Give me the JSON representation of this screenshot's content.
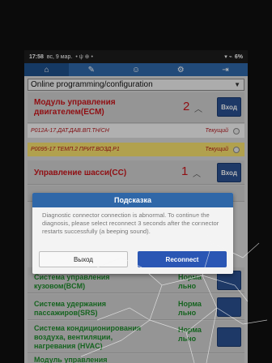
{
  "status_bar": {
    "time": "17:58",
    "date": "вс, 9 мар.",
    "icons": "•  ψ  ⊕  •",
    "signal_icons": "▾ ⌁",
    "battery": "6%"
  },
  "nav": {
    "items": [
      {
        "icon": "home-icon",
        "glyph": "⌂"
      },
      {
        "icon": "edit-icon",
        "glyph": "✎"
      },
      {
        "icon": "person-icon",
        "glyph": "☺"
      },
      {
        "icon": "settings-icon",
        "glyph": "⚙"
      },
      {
        "icon": "exit-icon",
        "glyph": "⇥"
      }
    ]
  },
  "section": {
    "title": "Online programming/configuration"
  },
  "modules": {
    "ecm": {
      "label": "Модуль управления двигателем(ECM)",
      "count": "2",
      "enter": "Вход"
    },
    "cc": {
      "label": "Управление шасси(CC)",
      "count": "1",
      "enter": "Вход"
    }
  },
  "dtcs": [
    {
      "code": "P012A-17.ДАТ.ДАВ.ВП.ТН/СН",
      "state": "Текущий"
    },
    {
      "code": "P0095-17 ТЕМП.2 ПРИТ.ВОЗД.Р1",
      "state": "Текущий"
    }
  ],
  "lower_rows": [
    {
      "label": "Система управления кузовом(BCM)",
      "status": "Норма льно"
    },
    {
      "label": "Система удержания пассажиров(SRS)",
      "status": "Норма льно"
    },
    {
      "label": "Система кондиционирования воздуха, вентиляции, нагревания (HVAC)",
      "status": "Норма льно"
    },
    {
      "label": "Модуль управления",
      "status": ""
    }
  ],
  "dialog": {
    "title": "Подсказка",
    "message": "Diagnostic connector connection is abnormal. To continue the diagnosis, please select reconnect 3 seconds after the connector restarts successfully (a beeping sound).",
    "exit_label": "Выход",
    "reconnect_label": "Reconnect"
  },
  "colors": {
    "nav_blue": "#2f67a8",
    "fault_red": "#c8151b",
    "ok_green": "#1e8a2c",
    "highlight_yellow": "#f6df6d",
    "button_blue": "#2a56b4"
  }
}
